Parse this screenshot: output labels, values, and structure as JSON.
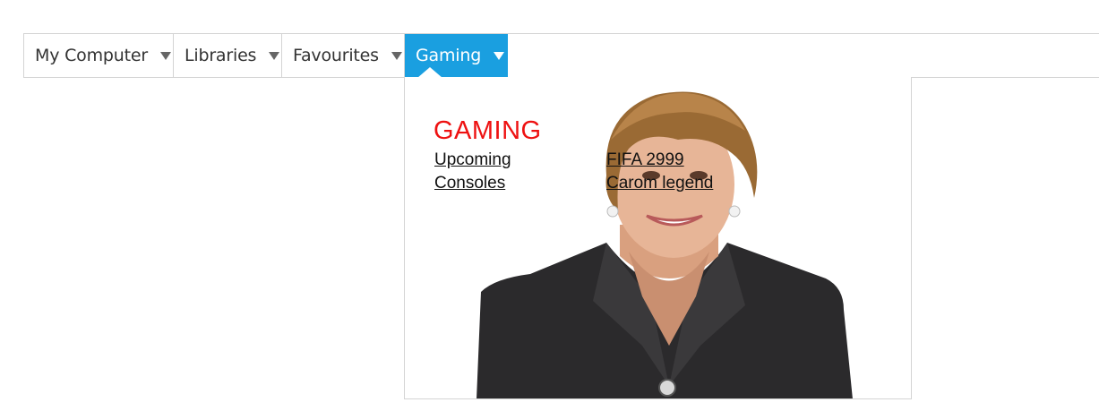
{
  "menu": {
    "items": [
      {
        "label": "My Computer"
      },
      {
        "label": "Libraries"
      },
      {
        "label": "Favourites"
      },
      {
        "label": "Gaming"
      }
    ],
    "active_color": "#1a9fe0"
  },
  "dropdown": {
    "title": "GAMING",
    "title_color": "#ee1111",
    "col1": [
      "Upcoming",
      "Consoles"
    ],
    "col2": [
      "FIFA 2999",
      "Carom legend"
    ]
  }
}
